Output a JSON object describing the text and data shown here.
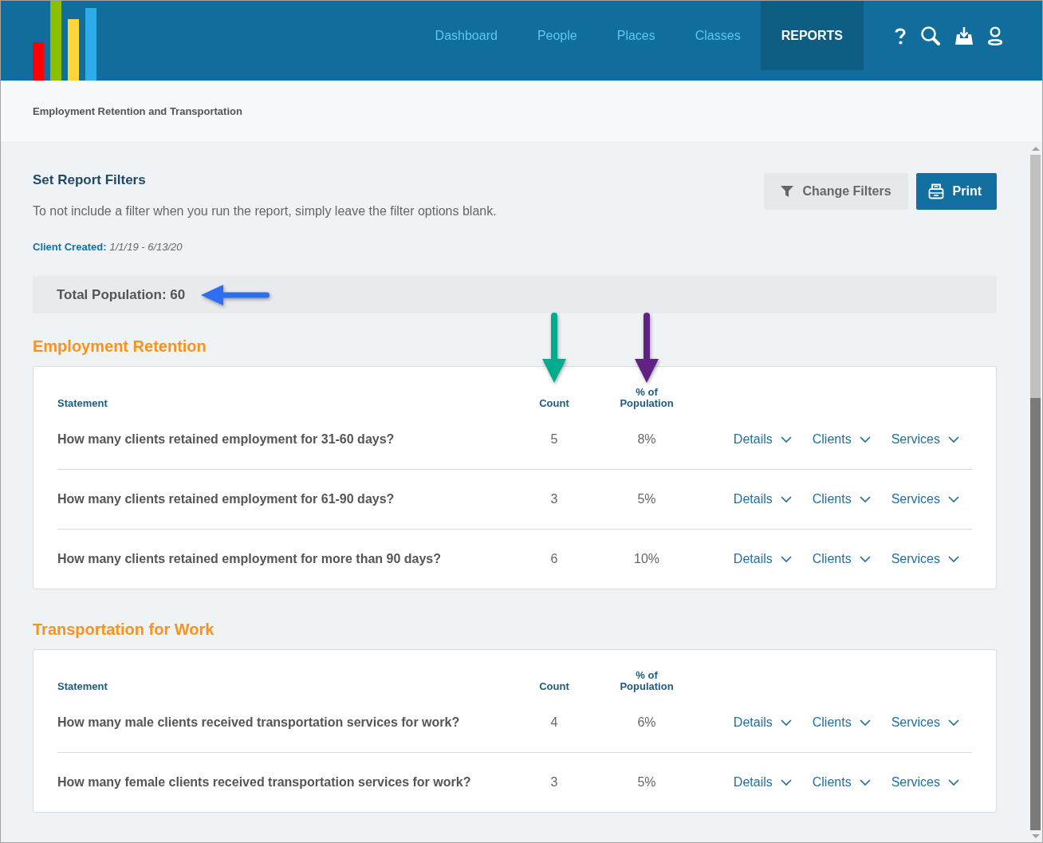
{
  "header": {
    "nav": [
      {
        "label": "Dashboard",
        "selected": false
      },
      {
        "label": "People",
        "selected": false
      },
      {
        "label": "Places",
        "selected": false
      },
      {
        "label": "Classes",
        "selected": false
      },
      {
        "label": "REPORTS",
        "selected": true
      }
    ]
  },
  "page_title": "Employment Retention and Transportation",
  "filters_panel": {
    "title": "Set Report Filters",
    "description": "To not include a filter when you run the report, simply leave the filter options blank.",
    "buttons": [
      {
        "label": "Change Filters",
        "kind": "secondary"
      },
      {
        "label": "Print",
        "kind": "primary"
      }
    ],
    "filters": [
      {
        "label": "Client Created:",
        "value": "1/1/19 - 6/13/20"
      }
    ]
  },
  "total_population": {
    "text": "Total Population: 60",
    "arrow": {
      "color": "#2e6ef0"
    }
  },
  "sections": [
    {
      "title": "Employment Retention",
      "columns": [
        {
          "label": "Statement"
        },
        {
          "label": "Count",
          "arrow": {
            "color": "#00ac8b"
          }
        },
        {
          "label": "% of Population",
          "arrow": {
            "color": "#602283"
          }
        }
      ],
      "rows": [
        {
          "statement": "How many clients retained employment for 31-60 days?",
          "count": "5",
          "percent": "8%",
          "links": [
            "Details",
            "Clients",
            "Services"
          ]
        },
        {
          "statement": "How many clients retained employment for 61-90 days?",
          "count": "3",
          "percent": "5%",
          "links": [
            "Details",
            "Clients",
            "Services"
          ]
        },
        {
          "statement": "How many clients retained employment for more than 90 days?",
          "count": "6",
          "percent": "10%",
          "links": [
            "Details",
            "Clients",
            "Services"
          ]
        }
      ]
    },
    {
      "title": "Transportation for Work",
      "columns": [
        {
          "label": "Statement"
        },
        {
          "label": "Count"
        },
        {
          "label": "% of Population"
        }
      ],
      "rows": [
        {
          "statement": "How many male clients received transportation services for work?",
          "count": "4",
          "percent": "6%",
          "links": [
            "Details",
            "Clients",
            "Services"
          ]
        },
        {
          "statement": "How many female clients received transportation services for work?",
          "count": "3",
          "percent": "5%",
          "links": [
            "Details",
            "Clients",
            "Services"
          ]
        }
      ]
    }
  ]
}
